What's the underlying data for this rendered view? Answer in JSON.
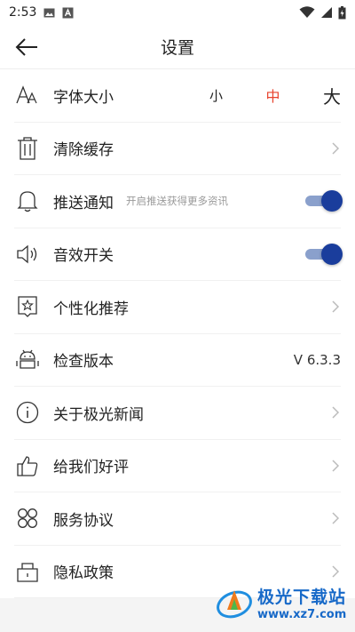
{
  "status_bar": {
    "time": "2:53"
  },
  "header": {
    "title": "设置"
  },
  "settings": {
    "font_size": {
      "label": "字体大小",
      "small": "小",
      "medium": "中",
      "large": "大"
    },
    "clear_cache": {
      "label": "清除缓存"
    },
    "push": {
      "label": "推送通知",
      "hint": "开启推送获得更多资讯",
      "enabled": true
    },
    "sound": {
      "label": "音效开关",
      "enabled": true
    },
    "personalized": {
      "label": "个性化推荐"
    },
    "version": {
      "label": "检查版本",
      "value": "V 6.3.3"
    },
    "about": {
      "label": "关于极光新闻"
    },
    "rate": {
      "label": "给我们好评"
    },
    "service": {
      "label": "服务协议"
    },
    "privacy": {
      "label": "隐私政策"
    }
  },
  "watermark": {
    "name": "极光下载站",
    "url": "www.xz7.com"
  },
  "colors": {
    "accent_red": "#e8442e",
    "toggle_on": "#1a3d9c",
    "watermark": "#1769c8"
  }
}
